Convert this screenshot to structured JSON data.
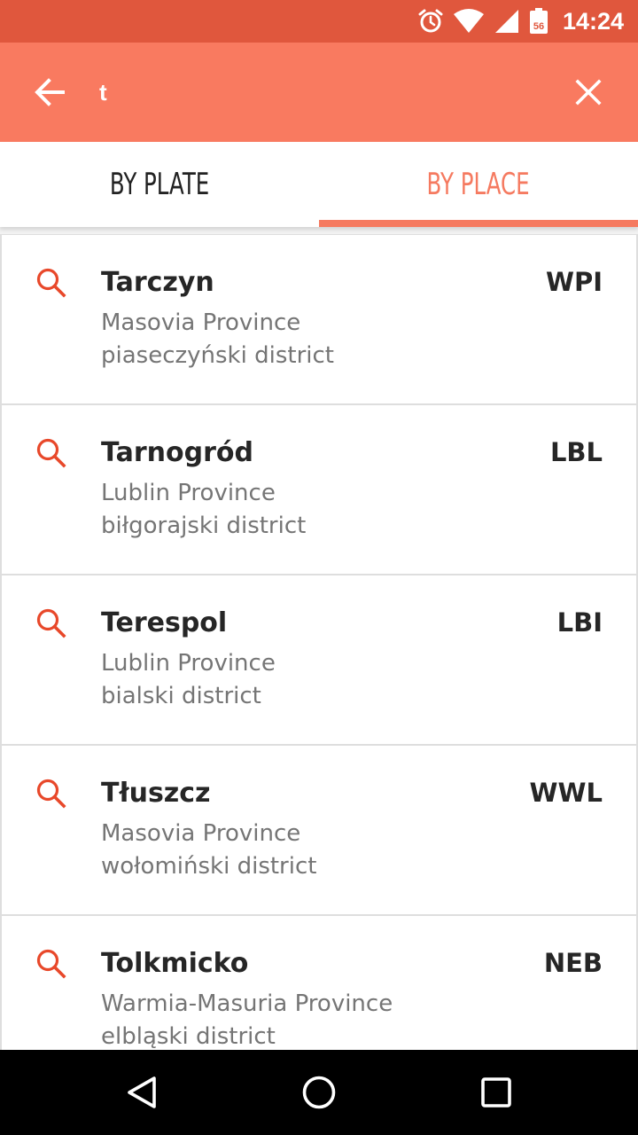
{
  "status_bar": {
    "time": "14:24",
    "calendar_badge": "56",
    "icons": [
      "alarm-icon",
      "wifi-icon",
      "signal-icon",
      "calendar-icon"
    ]
  },
  "search": {
    "query": "t",
    "back_icon": "arrow-left-icon",
    "clear_icon": "close-icon"
  },
  "tabs": [
    {
      "label": "BY PLATE",
      "active": false
    },
    {
      "label": "BY PLACE",
      "active": true
    }
  ],
  "colors": {
    "status_bar": "#e0573d",
    "app_bar": "#f97a60",
    "accent": "#f57a60",
    "search_icon": "#e8482a"
  },
  "results": [
    {
      "name": "Tarczyn",
      "code": "WPI",
      "province": "Masovia Province",
      "district": "piaseczyński district"
    },
    {
      "name": "Tarnogród",
      "code": "LBL",
      "province": "Lublin Province",
      "district": "biłgorajski district"
    },
    {
      "name": "Terespol",
      "code": "LBI",
      "province": "Lublin Province",
      "district": "bialski district"
    },
    {
      "name": "Tłuszcz",
      "code": "WWL",
      "province": "Masovia Province",
      "district": "wołomiński district"
    },
    {
      "name": "Tolkmicko",
      "code": "NEB",
      "province": "Warmia-Masuria Province",
      "district": "elbląski district"
    }
  ],
  "nav_bar": {
    "icons": [
      "back-triangle-icon",
      "home-circle-icon",
      "recents-square-icon"
    ]
  }
}
